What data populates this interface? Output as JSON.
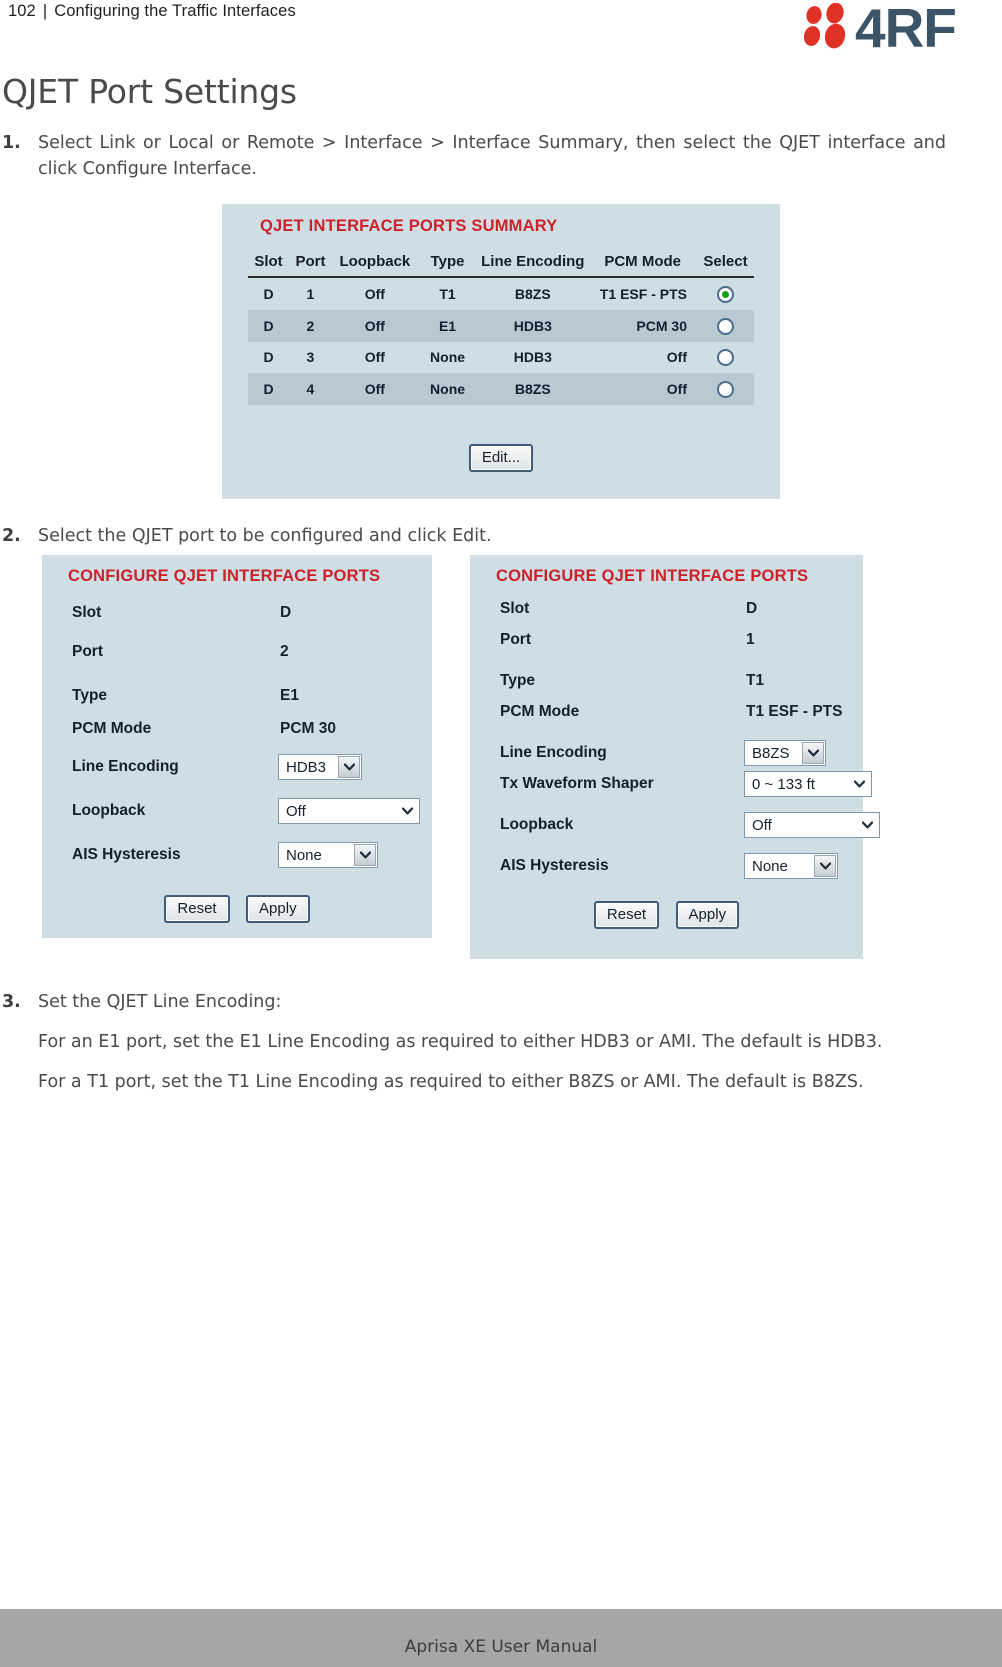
{
  "header": {
    "page_number": "102",
    "separator": "|",
    "section_title": "Configuring the Traffic Interfaces",
    "logo_text": "4RF",
    "logo_dot_color": "#e03127",
    "logo_text_color": "#3c5468"
  },
  "page_title": "QJET Port Settings",
  "steps": [
    {
      "number": "1.",
      "text": "Select Link or Local or Remote > Interface > Interface Summary, then select the QJET interface and click Configure Interface."
    },
    {
      "number": "2.",
      "text": "Select the QJET port to be configured and click Edit."
    },
    {
      "number": "3.",
      "text": "Set the QJET Line Encoding:"
    }
  ],
  "paragraphs": [
    "For an E1 port, set the E1 Line Encoding as required to either HDB3 or AMI. The default is HDB3.",
    "For a T1 port, set the T1 Line Encoding as required to either B8ZS or AMI. The default is B8ZS."
  ],
  "summary_panel": {
    "title": "QJET INTERFACE PORTS SUMMARY",
    "columns": [
      "Slot",
      "Port",
      "Loopback",
      "Type",
      "Line Encoding",
      "PCM Mode",
      "Select"
    ],
    "rows": [
      {
        "slot": "D",
        "port": "1",
        "loopback": "Off",
        "type": "T1",
        "line_encoding": "B8ZS",
        "pcm_mode": "T1 ESF - PTS",
        "selected": true
      },
      {
        "slot": "D",
        "port": "2",
        "loopback": "Off",
        "type": "E1",
        "line_encoding": "HDB3",
        "pcm_mode": "PCM 30",
        "selected": false
      },
      {
        "slot": "D",
        "port": "3",
        "loopback": "Off",
        "type": "None",
        "line_encoding": "HDB3",
        "pcm_mode": "Off",
        "selected": false
      },
      {
        "slot": "D",
        "port": "4",
        "loopback": "Off",
        "type": "None",
        "line_encoding": "B8ZS",
        "pcm_mode": "Off",
        "selected": false
      }
    ],
    "edit_button": "Edit..."
  },
  "configure_left": {
    "title": "CONFIGURE QJET INTERFACE PORTS",
    "slot_label": "Slot",
    "slot_value": "D",
    "port_label": "Port",
    "port_value": "2",
    "type_label": "Type",
    "type_value": "E1",
    "pcm_label": "PCM Mode",
    "pcm_value": "PCM 30",
    "line_encoding_label": "Line Encoding",
    "line_encoding_value": "HDB3",
    "loopback_label": "Loopback",
    "loopback_value": "Off",
    "ais_label": "AIS Hysteresis",
    "ais_value": "None",
    "reset_button": "Reset",
    "apply_button": "Apply"
  },
  "configure_right": {
    "title": "CONFIGURE QJET INTERFACE PORTS",
    "slot_label": "Slot",
    "slot_value": "D",
    "port_label": "Port",
    "port_value": "1",
    "type_label": "Type",
    "type_value": "T1",
    "pcm_label": "PCM Mode",
    "pcm_value": "T1 ESF - PTS",
    "line_encoding_label": "Line Encoding",
    "line_encoding_value": "B8ZS",
    "tx_shaper_label": "Tx Waveform Shaper",
    "tx_shaper_value": "0 ~ 133 ft",
    "loopback_label": "Loopback",
    "loopback_value": "Off",
    "ais_label": "AIS Hysteresis",
    "ais_value": "None",
    "reset_button": "Reset",
    "apply_button": "Apply"
  },
  "footer": {
    "text": "Aprisa XE User Manual"
  }
}
